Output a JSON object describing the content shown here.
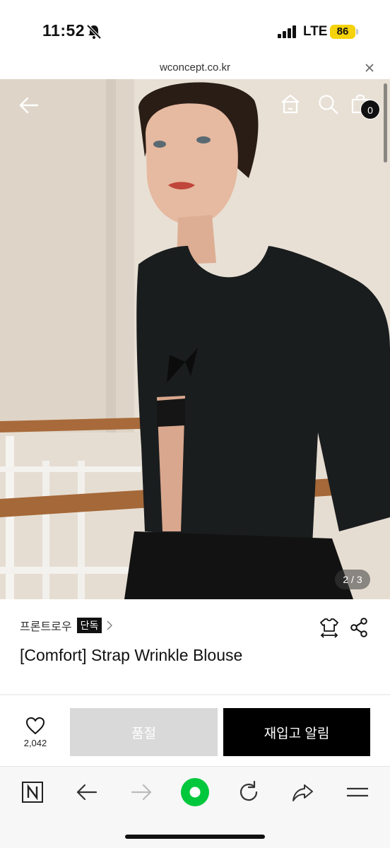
{
  "status_bar": {
    "time": "11:52",
    "network": "LTE",
    "battery": "86"
  },
  "browser": {
    "url": "wconcept.co.kr"
  },
  "product_header": {
    "cart_count": "0",
    "image_counter": "2 / 3"
  },
  "product": {
    "brand": "프론트로우",
    "exclusive_badge": "단독",
    "title": "[Comfort] Strap Wrinkle Blouse"
  },
  "actions": {
    "wish_count": "2,042",
    "soldout_label": "품절",
    "restock_label": "재입고 알림"
  },
  "colors": {
    "accent_green": "#00c73c",
    "battery_yellow": "#f5d20a",
    "cta_black": "#000000",
    "disabled_gray": "#d9d9d9"
  },
  "icons": [
    "bell-slash-icon",
    "signal-icon",
    "close-icon",
    "back-arrow-icon",
    "home-icon",
    "search-icon",
    "shopping-bag-icon",
    "chevron-right-icon",
    "size-guide-icon",
    "share-icon",
    "heart-icon",
    "naver-icon",
    "refresh-icon"
  ]
}
